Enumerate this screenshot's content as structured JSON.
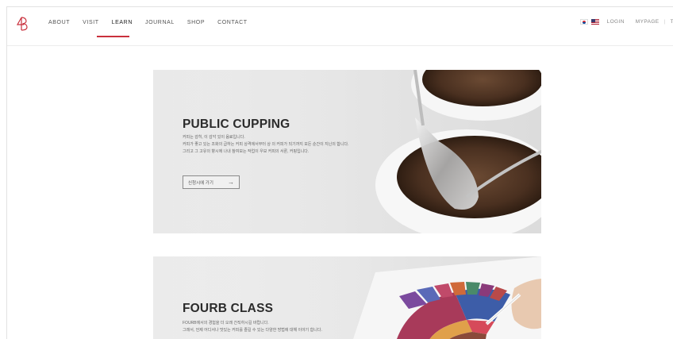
{
  "header": {
    "logo_text": "4B",
    "nav": [
      {
        "label": "ABOUT"
      },
      {
        "label": "VISIT"
      },
      {
        "label": "LEARN"
      },
      {
        "label": "JOURNAL"
      },
      {
        "label": "SHOP"
      },
      {
        "label": "CONTACT"
      }
    ],
    "active_nav": "LEARN",
    "util": {
      "login": "LOGIN",
      "mypage": "MYPAGE",
      "separator": "|",
      "cut_off": "T"
    }
  },
  "banners": [
    {
      "title": "PUBLIC CUPPING",
      "lines": [
        "커피는 감히, 이 감각 있이 음료입니다.",
        "커피가 좋고 있는 조화의 급하는 커피 상격에서부터 상 의 커피가 되기까지 모든 순간이 지닌의 합니다.",
        "그리고 그 고유의 향시에 나내 참여보는 작업이 우보 커피의 서론, 커핑입니다."
      ],
      "cta_label": "신청시에 가기",
      "cta_arrow": "→"
    },
    {
      "title": "FOURB CLASS",
      "lines": [
        "FOURB에서의 경험을 더 오래 간직하시길 바랍니다.",
        "그래서, 언제 어디서나 맛있는 커피를 즐길 수 있는 다양한 방법에 대해 이야기 합니다."
      ]
    }
  ],
  "colors": {
    "accent": "#c9303c",
    "title": "#2b2b2b",
    "banner_bg": "#e6e6e6"
  }
}
